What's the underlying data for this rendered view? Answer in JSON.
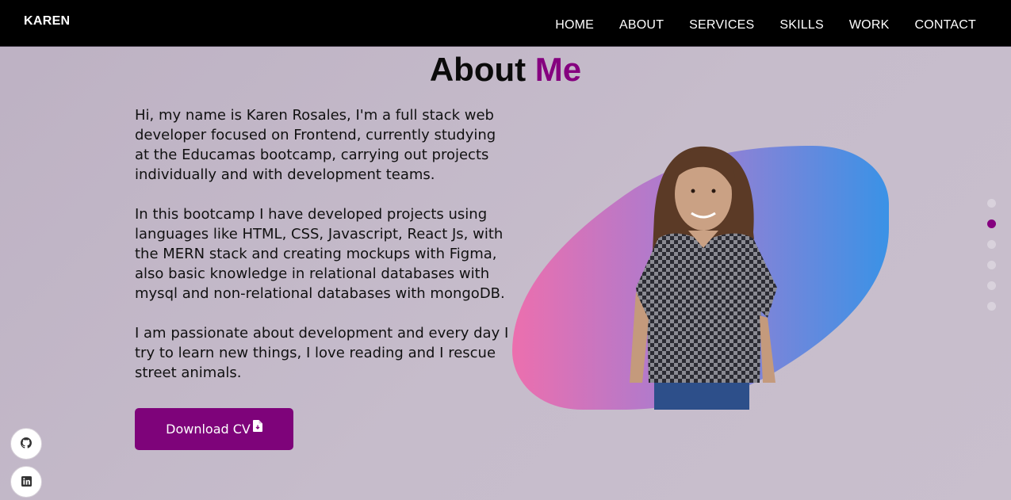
{
  "nav": {
    "brand": "KAREN",
    "links": [
      "HOME",
      "ABOUT",
      "SERVICES",
      "SKILLS",
      "WORK",
      "CONTACT"
    ]
  },
  "about": {
    "title_main": "About",
    "title_accent": "Me",
    "paragraphs": [
      "Hi, my name is Karen Rosales, I'm a full stack web developer focused on Frontend, currently studying at the Educamas bootcamp, carrying out projects individually and with development teams.",
      "In this bootcamp I have developed projects using languages like HTML, CSS, Javascript, React Js, with the MERN stack and creating mockups with Figma, also basic knowledge in relational databases with mysql and non-relational databases with mongoDB.",
      "I am passionate about development and every day I try to learn new things, I love reading and I rescue street animals."
    ],
    "cv_button_label": "Download CV",
    "cv_button_icon": "file-download-icon"
  },
  "section_dots": {
    "count": 6,
    "active_index": 1
  },
  "social": [
    {
      "icon": "github-icon"
    },
    {
      "icon": "linkedin-icon"
    }
  ],
  "colors": {
    "accent": "#85007f",
    "navbar": "#000000",
    "button": "#7e037a",
    "blob_pink": "#ec6fae",
    "blob_blue": "#3a92e6"
  }
}
